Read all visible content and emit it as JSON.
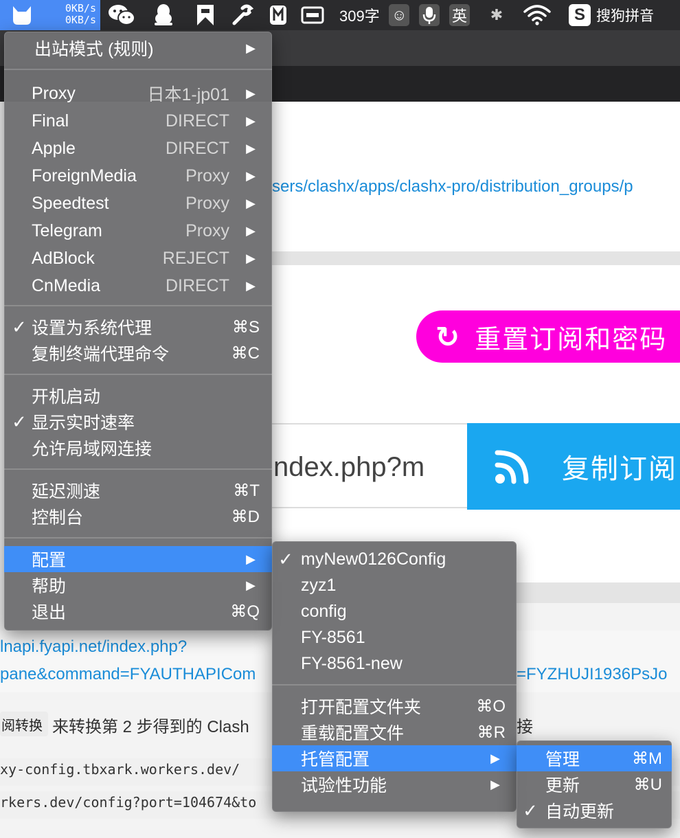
{
  "menubar": {
    "clash_upload": "0KB/s",
    "clash_download": "0KB/s",
    "word_count": "309字",
    "emoji_glyph": "☺",
    "mic_glyph": "🎙",
    "lang_label": "英",
    "bluetooth_glyph": "✱",
    "ime_logo": "S",
    "ime_name": "搜狗拼音"
  },
  "background": {
    "url_top": "sers/clashx/apps/clashx-pro/distribution_groups/p",
    "reset_button": "重置订阅和密码",
    "subscribe_input_value": "ndex.php?m",
    "copy_button": "复制订阅",
    "link_line1": "lnapi.fyapi.net/index.php?",
    "link_line2": "pane&command=FYAUTHAPICom",
    "link_line2_tail": "=FYZHUJI1936PsJo",
    "convert_tag": "阅转换",
    "convert_text": "来转换第 2 步得到的 Clash",
    "convert_tail": "接",
    "code_line1": "xy-config.tbxark.workers.dev/",
    "code_line2": "rkers.dev/config?port=104674&to"
  },
  "main_menu": {
    "outbound_mode": {
      "label": "出站模式 (规则)"
    },
    "proxy_groups": [
      {
        "label": "Proxy",
        "value": "日本1-jp01"
      },
      {
        "label": "Final",
        "value": "DIRECT"
      },
      {
        "label": "Apple",
        "value": "DIRECT"
      },
      {
        "label": "ForeignMedia",
        "value": "Proxy"
      },
      {
        "label": "Speedtest",
        "value": "Proxy"
      },
      {
        "label": "Telegram",
        "value": "Proxy"
      },
      {
        "label": "AdBlock",
        "value": "REJECT"
      },
      {
        "label": "CnMedia",
        "value": "DIRECT"
      }
    ],
    "set_system_proxy": {
      "label": "设置为系统代理",
      "shortcut": "⌘S",
      "checked": true
    },
    "copy_terminal_cmd": {
      "label": "复制终端代理命令",
      "shortcut": "⌘C"
    },
    "launch_at_login": {
      "label": "开机启动"
    },
    "show_speed": {
      "label": "显示实时速率",
      "checked": true
    },
    "allow_lan": {
      "label": "允许局域网连接"
    },
    "latency_test": {
      "label": "延迟测速",
      "shortcut": "⌘T"
    },
    "console": {
      "label": "控制台",
      "shortcut": "⌘D"
    },
    "config": {
      "label": "配置"
    },
    "help": {
      "label": "帮助"
    },
    "quit": {
      "label": "退出",
      "shortcut": "⌘Q"
    },
    "check_glyph": "✓",
    "arrow_glyph": "▶"
  },
  "config_menu": {
    "configs": [
      {
        "label": "myNew0126Config",
        "checked": true
      },
      {
        "label": "zyz1"
      },
      {
        "label": "config"
      },
      {
        "label": "FY-8561"
      },
      {
        "label": "FY-8561-new"
      }
    ],
    "open_folder": {
      "label": "打开配置文件夹",
      "shortcut": "⌘O"
    },
    "reload": {
      "label": "重载配置文件",
      "shortcut": "⌘R"
    },
    "managed": {
      "label": "托管配置"
    },
    "experimental": {
      "label": "试验性功能"
    }
  },
  "managed_menu": {
    "manage": {
      "label": "管理",
      "shortcut": "⌘M"
    },
    "update": {
      "label": "更新",
      "shortcut": "⌘U"
    },
    "auto_update": {
      "label": "自动更新",
      "checked": true
    }
  },
  "colors": {
    "menubar_bg": "#2b2b2d",
    "clash_highlight": "#4a8bf5",
    "menu_bg": "#707072",
    "menu_highlight": "#3f8ef7",
    "reset_button": "#ff00dd",
    "copy_button": "#1aa7f0",
    "link": "#1a8cd8"
  }
}
